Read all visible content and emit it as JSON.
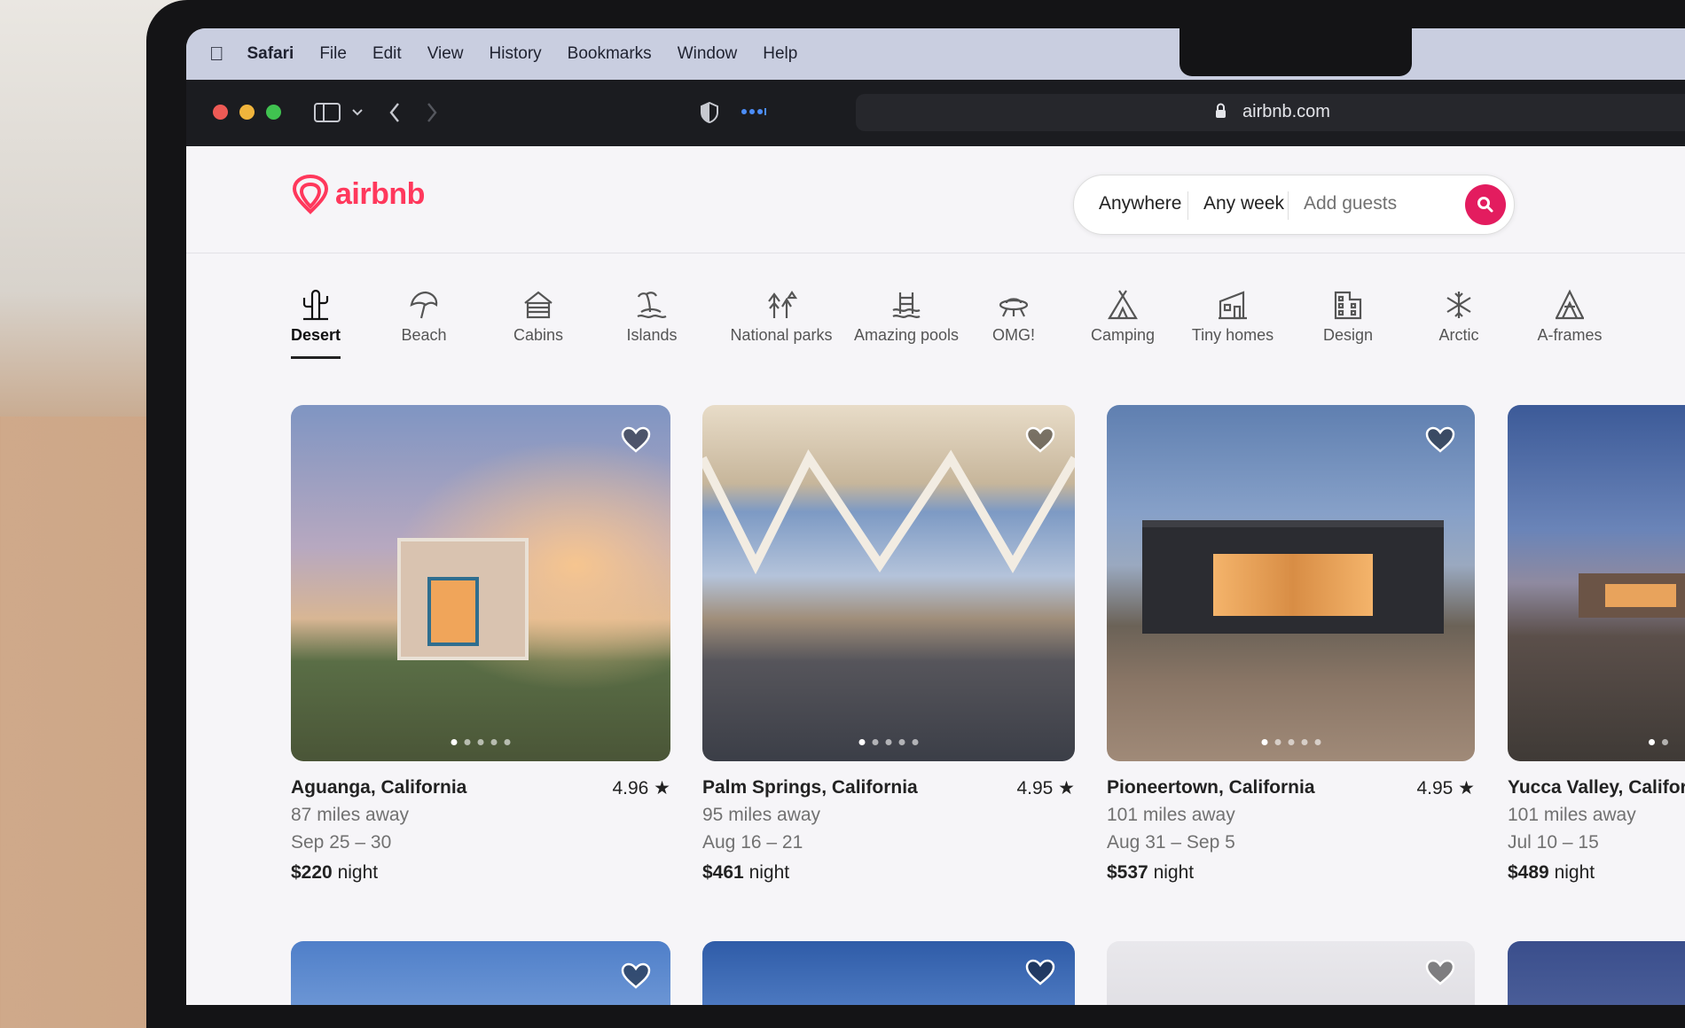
{
  "menubar": {
    "app": "Safari",
    "items": [
      "File",
      "Edit",
      "View",
      "History",
      "Bookmarks",
      "Window",
      "Help"
    ]
  },
  "toolbar": {
    "url": "airbnb.com"
  },
  "header": {
    "logo": "airbnb",
    "search": {
      "where": "Anywhere",
      "when": "Any week",
      "who": "Add guests"
    }
  },
  "categories": [
    {
      "label": "Desert",
      "icon": "cactus-icon"
    },
    {
      "label": "Beach",
      "icon": "umbrella-icon"
    },
    {
      "label": "Cabins",
      "icon": "cabin-icon"
    },
    {
      "label": "Islands",
      "icon": "palm-island-icon"
    },
    {
      "label": "National parks",
      "icon": "trees-icon"
    },
    {
      "label": "Amazing pools",
      "icon": "pool-icon"
    },
    {
      "label": "OMG!",
      "icon": "ufo-icon"
    },
    {
      "label": "Camping",
      "icon": "tent-icon"
    },
    {
      "label": "Tiny homes",
      "icon": "tiny-home-icon"
    },
    {
      "label": "Design",
      "icon": "building-icon"
    },
    {
      "label": "Arctic",
      "icon": "snowflake-icon"
    },
    {
      "label": "A-frames",
      "icon": "a-frame-icon"
    }
  ],
  "listings": [
    {
      "location": "Aguanga, California",
      "rating": "4.96",
      "distance": "87 miles away",
      "dates": "Sep 25 – 30",
      "price": "$220",
      "unit": "night"
    },
    {
      "location": "Palm Springs, California",
      "rating": "4.95",
      "distance": "95 miles away",
      "dates": "Aug 16 – 21",
      "price": "$461",
      "unit": "night"
    },
    {
      "location": "Pioneertown, California",
      "rating": "4.95",
      "distance": "101 miles away",
      "dates": "Aug 31 – Sep 5",
      "price": "$537",
      "unit": "night"
    },
    {
      "location": "Yucca Valley, Califor",
      "rating": "",
      "distance": "101 miles away",
      "dates": "Jul 10 – 15",
      "price": "$489",
      "unit": "night"
    }
  ],
  "colors": {
    "brand": "#ff385c",
    "search_button": "#e31c5f"
  }
}
